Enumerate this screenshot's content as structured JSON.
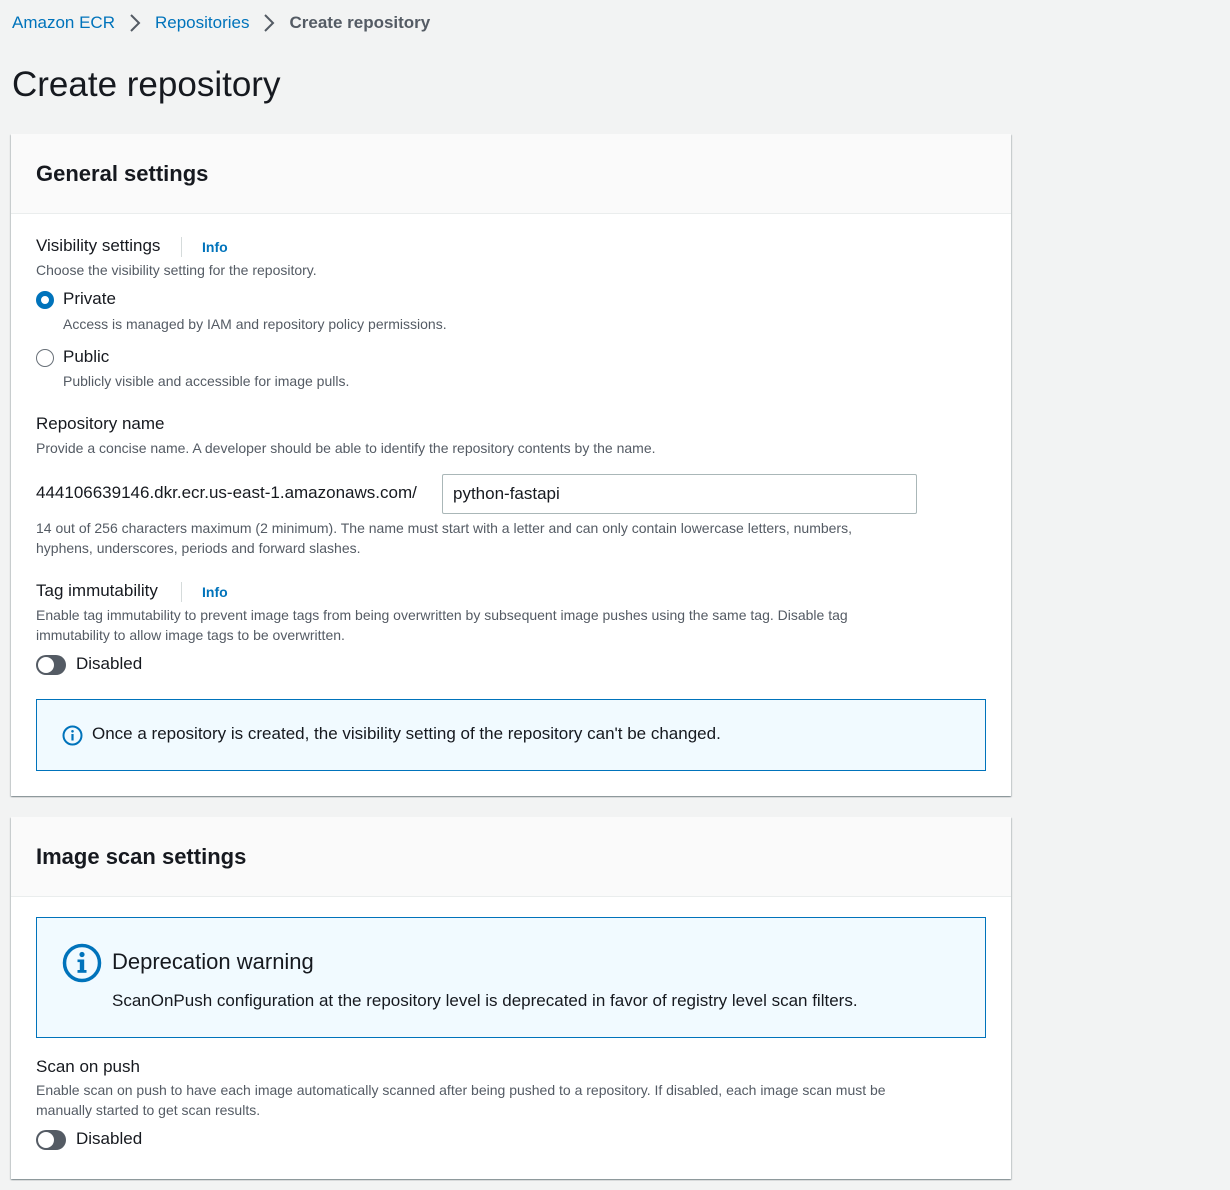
{
  "breadcrumb": {
    "items": [
      "Amazon ECR",
      "Repositories"
    ],
    "current": "Create repository"
  },
  "page": {
    "title": "Create repository"
  },
  "general_settings": {
    "title": "General settings",
    "visibility": {
      "label": "Visibility settings",
      "info": "Info",
      "description": "Choose the visibility setting for the repository.",
      "options": [
        {
          "label": "Private",
          "description": "Access is managed by IAM and repository policy permissions.",
          "selected": true
        },
        {
          "label": "Public",
          "description": "Publicly visible and accessible for image pulls.",
          "selected": false
        }
      ]
    },
    "repository_name": {
      "label": "Repository name",
      "description": "Provide a concise name. A developer should be able to identify the repository contents by the name.",
      "prefix": "444106639146.dkr.ecr.us-east-1.amazonaws.com/",
      "value": "python-fastapi",
      "constraint_line1": "14 out of 256 characters maximum (2 minimum). The name must start with a letter and can only contain lowercase letters, numbers,",
      "constraint_line2": "hyphens, underscores, periods and forward slashes."
    },
    "tag_immutability": {
      "label": "Tag immutability",
      "info": "Info",
      "description_line1": "Enable tag immutability to prevent image tags from being overwritten by subsequent image pushes using the same tag. Disable tag",
      "description_line2": "immutability to allow image tags to be overwritten.",
      "toggle_label": "Disabled",
      "enabled": false
    },
    "alert": {
      "icon": "info-icon",
      "text": "Once a repository is created, the visibility setting of the repository can't be changed."
    }
  },
  "image_scan_settings": {
    "title": "Image scan settings",
    "warning": {
      "icon": "info-icon",
      "title": "Deprecation warning",
      "text": "ScanOnPush configuration at the repository level is deprecated in favor of registry level scan filters."
    },
    "scan_on_push": {
      "label": "Scan on push",
      "description_line1": "Enable scan on push to have each image automatically scanned after being pushed to a repository. If disabled, each image scan must be",
      "description_line2": "manually started to get scan results.",
      "toggle_label": "Disabled",
      "enabled": false
    }
  },
  "colors": {
    "link": "#0073bb",
    "background": "#f2f3f3",
    "panel": "#ffffff",
    "text": "#16191f",
    "secondary_text": "#545b64",
    "alert_background": "#f1faff"
  }
}
